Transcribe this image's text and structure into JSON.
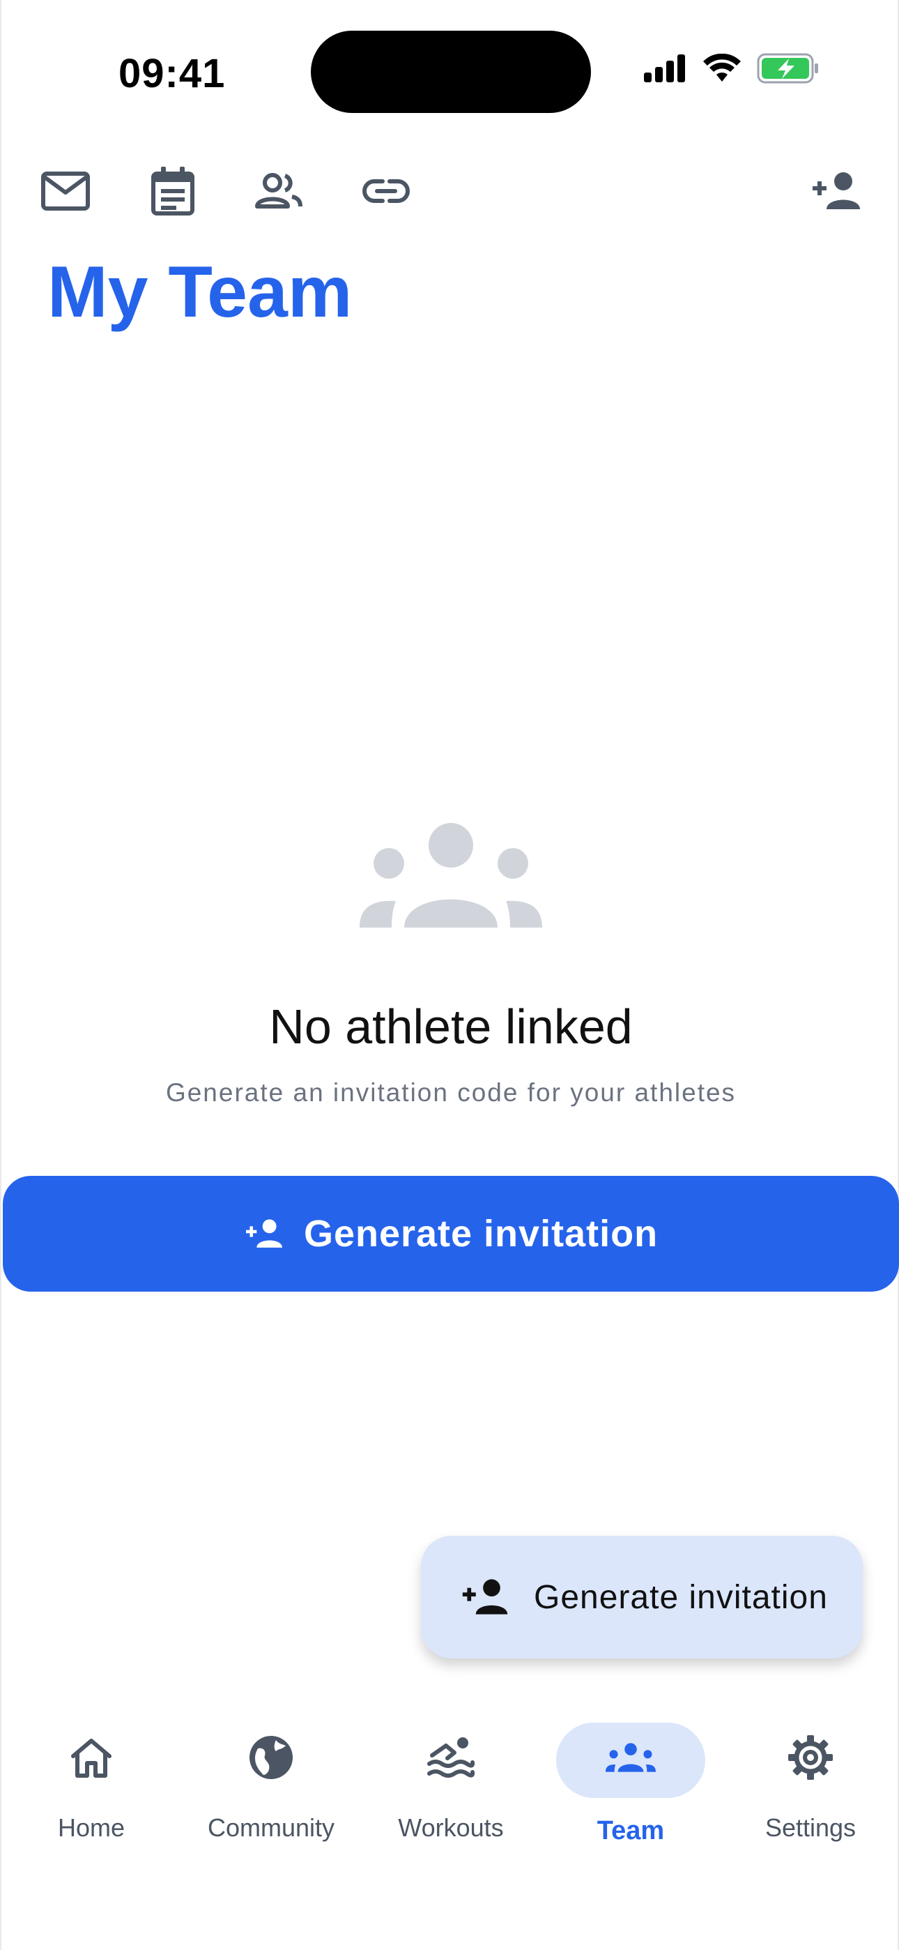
{
  "status_bar": {
    "time": "09:41"
  },
  "header": {
    "title": "My Team"
  },
  "empty_state": {
    "title": "No athlete linked",
    "subtitle": "Generate an invitation code for your athletes"
  },
  "primary_button": {
    "label": "Generate invitation"
  },
  "fab": {
    "label": "Generate invitation"
  },
  "nav": {
    "items": [
      {
        "label": "Home"
      },
      {
        "label": "Community"
      },
      {
        "label": "Workouts"
      },
      {
        "label": "Team"
      },
      {
        "label": "Settings"
      }
    ],
    "active": "Team"
  },
  "colors": {
    "accent": "#2563eb",
    "accent_light": "#dbe6fb",
    "icon_gray": "#4b5563",
    "muted": "#d1d5db"
  },
  "icons": [
    "mail-icon",
    "calendar-icon",
    "group-icon",
    "link-icon",
    "person-add-icon",
    "home-icon",
    "globe-icon",
    "swim-icon",
    "team-icon",
    "gear-icon"
  ]
}
